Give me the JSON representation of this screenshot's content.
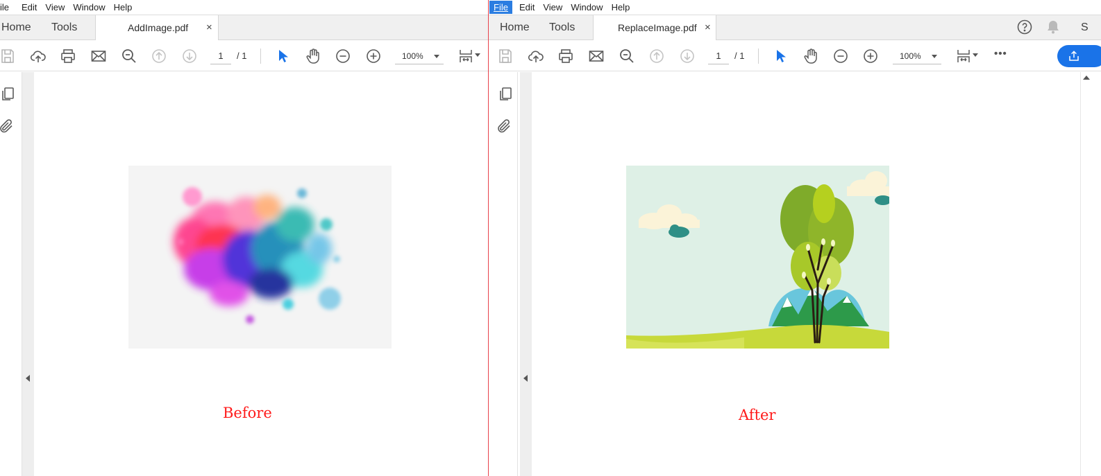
{
  "colors": {
    "accent": "#2b7de1",
    "caption_red": "#ff1a1a",
    "share_blue": "#1a73e8",
    "divider_red": "#e8414a"
  },
  "left_window": {
    "menu": [
      "ile",
      "Edit",
      "View",
      "Window",
      "Help"
    ],
    "nav": {
      "home": "Home",
      "tools": "Tools"
    },
    "tab": {
      "filename": "AddImage.pdf",
      "close": "×"
    },
    "page": {
      "current": "1",
      "total": "/ 1"
    },
    "zoom": "100%",
    "caption": "Before"
  },
  "right_window": {
    "menu": [
      "File",
      "Edit",
      "View",
      "Window",
      "Help"
    ],
    "active_menu": "File",
    "nav": {
      "home": "Home",
      "tools": "Tools"
    },
    "tab": {
      "filename": "ReplaceImage.pdf",
      "close": "×"
    },
    "page": {
      "current": "1",
      "total": "/ 1"
    },
    "zoom": "100%",
    "more": "•••",
    "cut_off_label": "S",
    "caption": "After"
  },
  "icons": [
    "save-icon",
    "upload-icon",
    "print-icon",
    "email-icon",
    "zoom-search-icon",
    "page-up-icon",
    "page-down-icon",
    "select-arrow-icon",
    "hand-icon",
    "zoom-out-icon",
    "zoom-in-icon",
    "fit-page-icon",
    "pages-icon",
    "attachment-icon",
    "help-icon",
    "bell-icon",
    "share-icon"
  ]
}
